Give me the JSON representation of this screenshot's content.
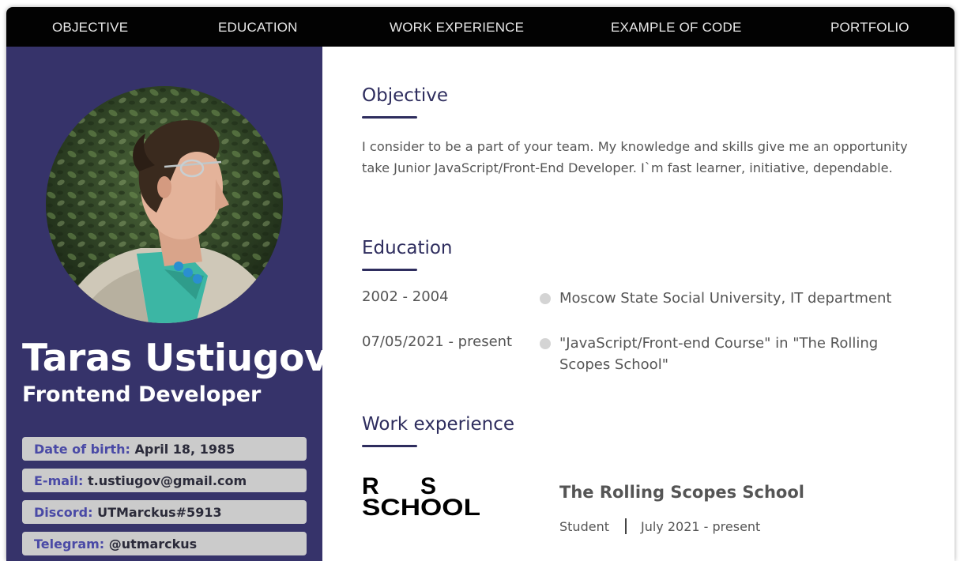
{
  "nav": {
    "items": [
      "OBJECTIVE",
      "EDUCATION",
      "WORK EXPERIENCE",
      "EXAMPLE OF CODE",
      "PORTFOLIO"
    ]
  },
  "profile": {
    "name": "Taras Ustiugov",
    "role": "Frontend Developer",
    "contacts": [
      {
        "key": "Date of birth:",
        "value": "April 18, 1985"
      },
      {
        "key": "E-mail:",
        "value": "t.ustiugov@gmail.com"
      },
      {
        "key": "Discord:",
        "value": "UTMarckus#5913"
      },
      {
        "key": "Telegram:",
        "value": "@utmarckus"
      }
    ]
  },
  "objective": {
    "heading": "Objective",
    "text": "I consider to be a part of your team. My knowledge and skills give me an opportunity take Junior JavaScript/Front-End Developer. I`m fast learner, initiative, dependable."
  },
  "education": {
    "heading": "Education",
    "items": [
      {
        "date": "2002 - 2004",
        "place": "Moscow State Social University, IT department"
      },
      {
        "date": "07/05/2021 - present",
        "place": "\"JavaScript/Front-end Course\" in \"The Rolling Scopes School\""
      }
    ]
  },
  "work": {
    "heading": "Work experience",
    "logo_text": {
      "line1_left": "R",
      "line1_right": "S",
      "line2": "SCHOOL"
    },
    "company": "The Rolling Scopes School",
    "position": "Student",
    "period": "July 2021 - present"
  },
  "colors": {
    "sidebar": "#36336a",
    "accent": "#2e2d5e",
    "nav_bg": "#020202",
    "contact_bg": "#cbcbcb",
    "contact_key": "#4a4aa6"
  }
}
